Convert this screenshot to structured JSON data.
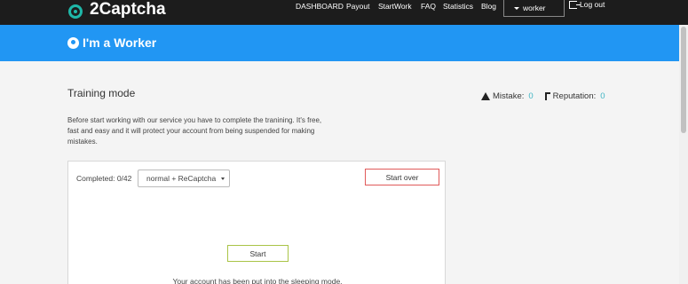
{
  "brand": {
    "name": "2Captcha",
    "icon": "captcha-logo-icon",
    "accent": "#1fb7a8"
  },
  "nav": {
    "links": [
      "DASHBOARD",
      "Payout",
      "StartWork",
      "FAQ",
      "Statistics",
      "Blog"
    ],
    "user": "worker",
    "logout": "Log out"
  },
  "header": {
    "title": "I'm a Worker",
    "icon": "worker-icon",
    "color": "#2196f3"
  },
  "training": {
    "title": "Training mode",
    "intro": "Before start working with our service you have to complete the tranining. It's free, fast and easy and it will protect your account from being suspended for making mistakes.",
    "stats": {
      "mistake_label": "Mistake:",
      "mistake_value": "0",
      "reputation_label": "Reputation:",
      "reputation_value": "0"
    },
    "completed": "Completed: 0/42",
    "mode_selected": "normal + ReCaptcha",
    "start_over": "Start over",
    "start": "Start",
    "sleep_message": "Your account has been put into the sleeping mode."
  }
}
